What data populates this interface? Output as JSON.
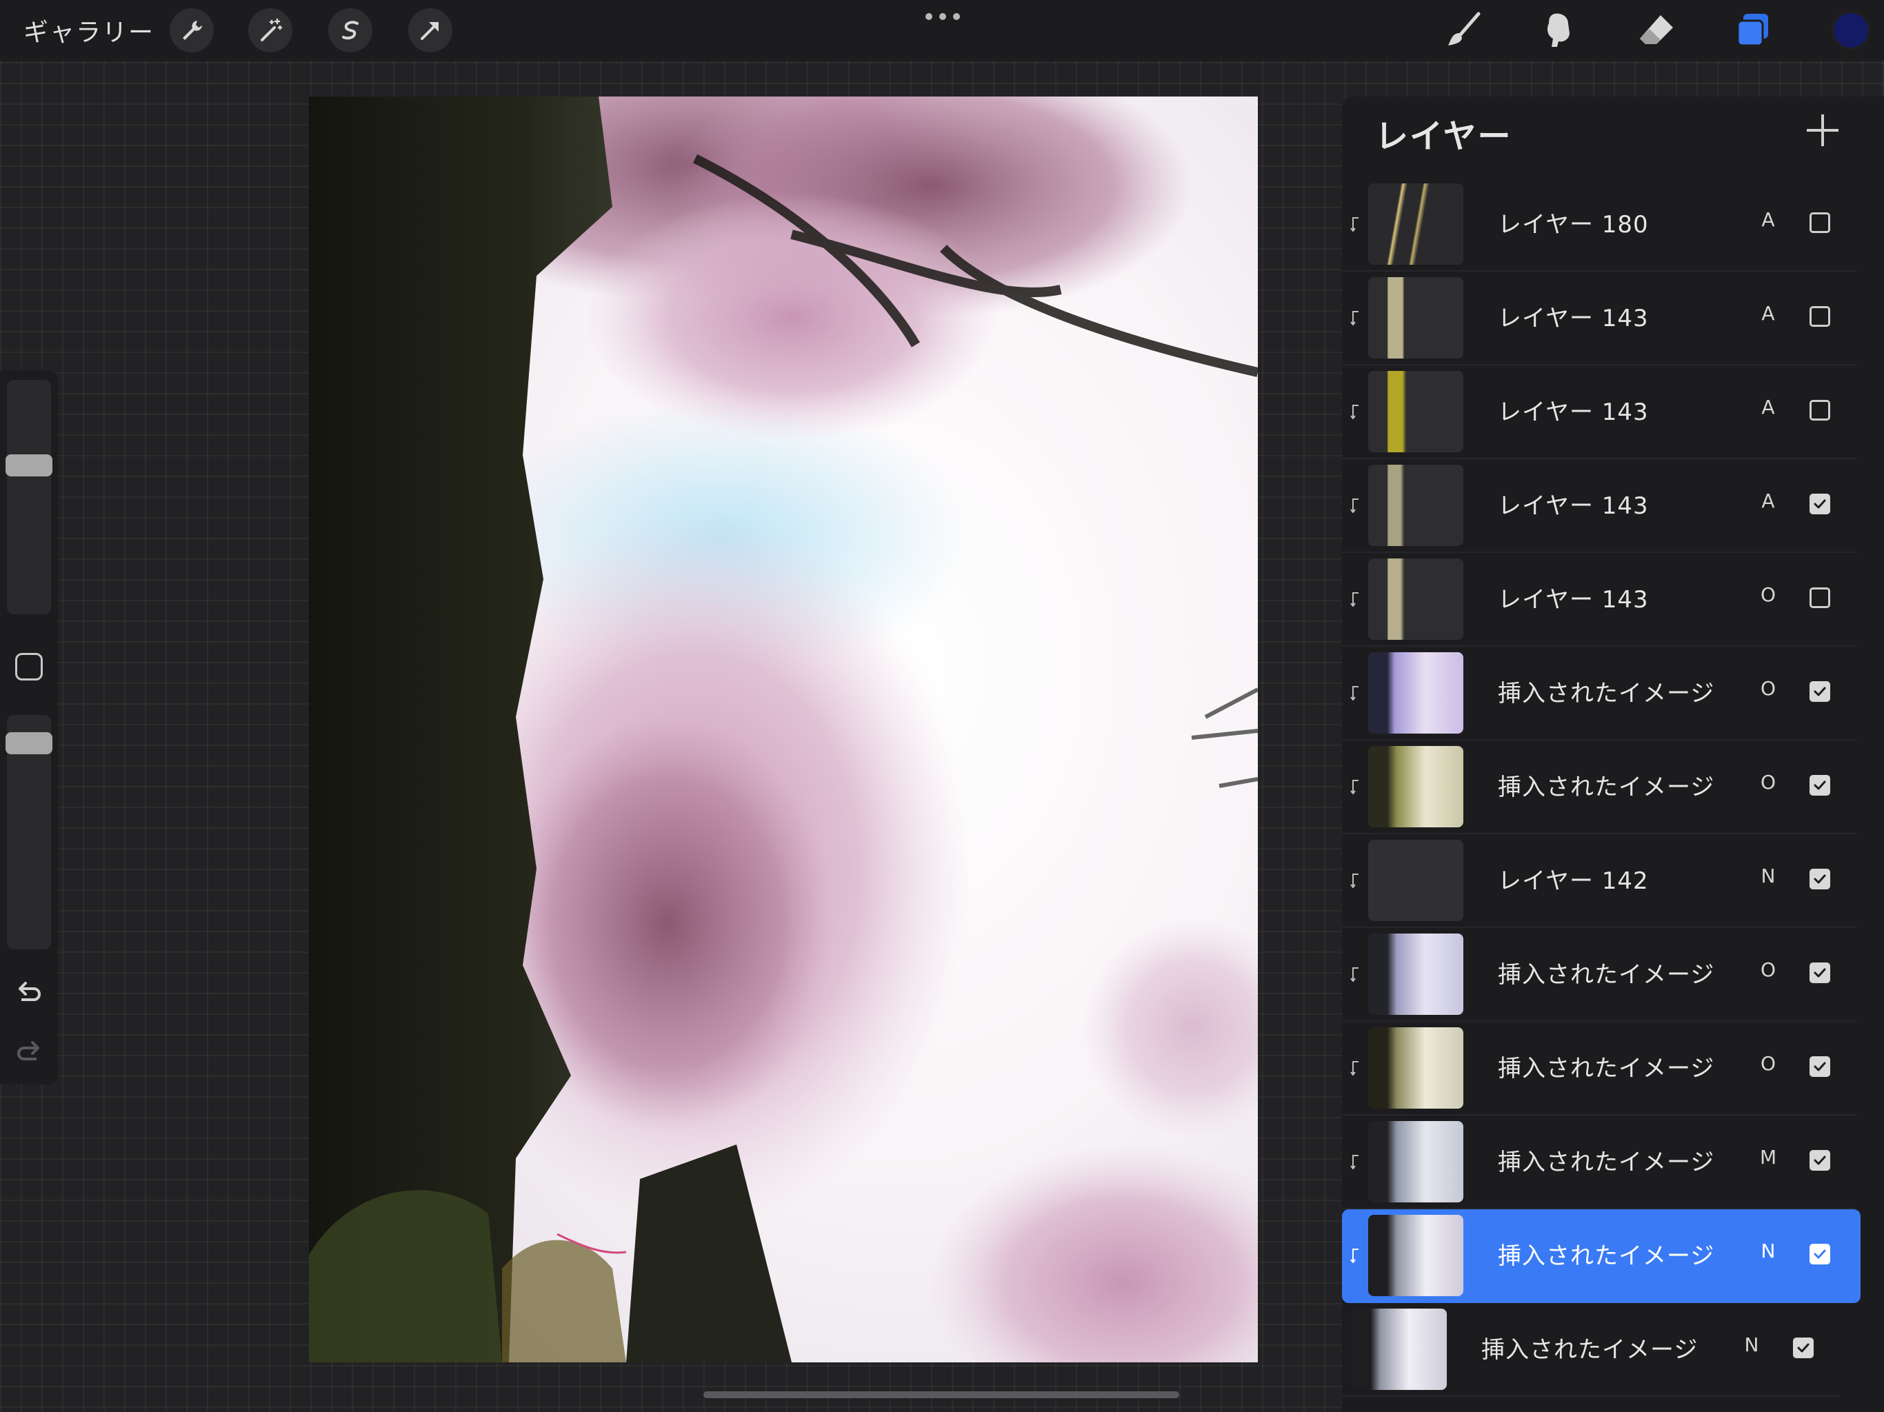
{
  "topbar": {
    "gallery_label": "ギャラリー",
    "left_tools": [
      "wrench-icon",
      "magic-wand-icon",
      "selection-icon",
      "transform-arrow-icon"
    ],
    "right_tools": [
      "brush-icon",
      "smudge-icon",
      "eraser-icon",
      "layers-icon"
    ],
    "active_tool": "layers-icon",
    "current_color": "#141a63",
    "accent_color": "#3a7bf5"
  },
  "sidebar": {
    "brush_size": 0.35,
    "brush_opacity": 0.08,
    "modify_button": "square-icon",
    "undo_icon": "undo-icon",
    "redo_icon": "redo-icon"
  },
  "canvas": {
    "subject": "cherry-blossom-tree-photo"
  },
  "layers_panel": {
    "title": "レイヤー",
    "add_icon": "plus-icon",
    "layers": [
      {
        "name": "レイヤー 180",
        "blend": "A",
        "visible": false,
        "clipped": true,
        "selected": false
      },
      {
        "name": "レイヤー 143",
        "blend": "A",
        "visible": false,
        "clipped": true,
        "selected": false
      },
      {
        "name": "レイヤー 143",
        "blend": "A",
        "visible": false,
        "clipped": true,
        "selected": false
      },
      {
        "name": "レイヤー 143",
        "blend": "A",
        "visible": true,
        "clipped": true,
        "selected": false
      },
      {
        "name": "レイヤー 143",
        "blend": "O",
        "visible": false,
        "clipped": true,
        "selected": false
      },
      {
        "name": "挿入されたイメージ",
        "blend": "O",
        "visible": true,
        "clipped": true,
        "selected": false
      },
      {
        "name": "挿入されたイメージ",
        "blend": "O",
        "visible": true,
        "clipped": true,
        "selected": false
      },
      {
        "name": "レイヤー 142",
        "blend": "N",
        "visible": true,
        "clipped": true,
        "selected": false
      },
      {
        "name": "挿入されたイメージ",
        "blend": "O",
        "visible": true,
        "clipped": true,
        "selected": false
      },
      {
        "name": "挿入されたイメージ",
        "blend": "O",
        "visible": true,
        "clipped": true,
        "selected": false
      },
      {
        "name": "挿入されたイメージ",
        "blend": "M",
        "visible": true,
        "clipped": true,
        "selected": false
      },
      {
        "name": "挿入されたイメージ",
        "blend": "N",
        "visible": true,
        "clipped": true,
        "selected": true
      },
      {
        "name": "挿入されたイメージ",
        "blend": "N",
        "visible": true,
        "clipped": false,
        "selected": false
      }
    ]
  }
}
